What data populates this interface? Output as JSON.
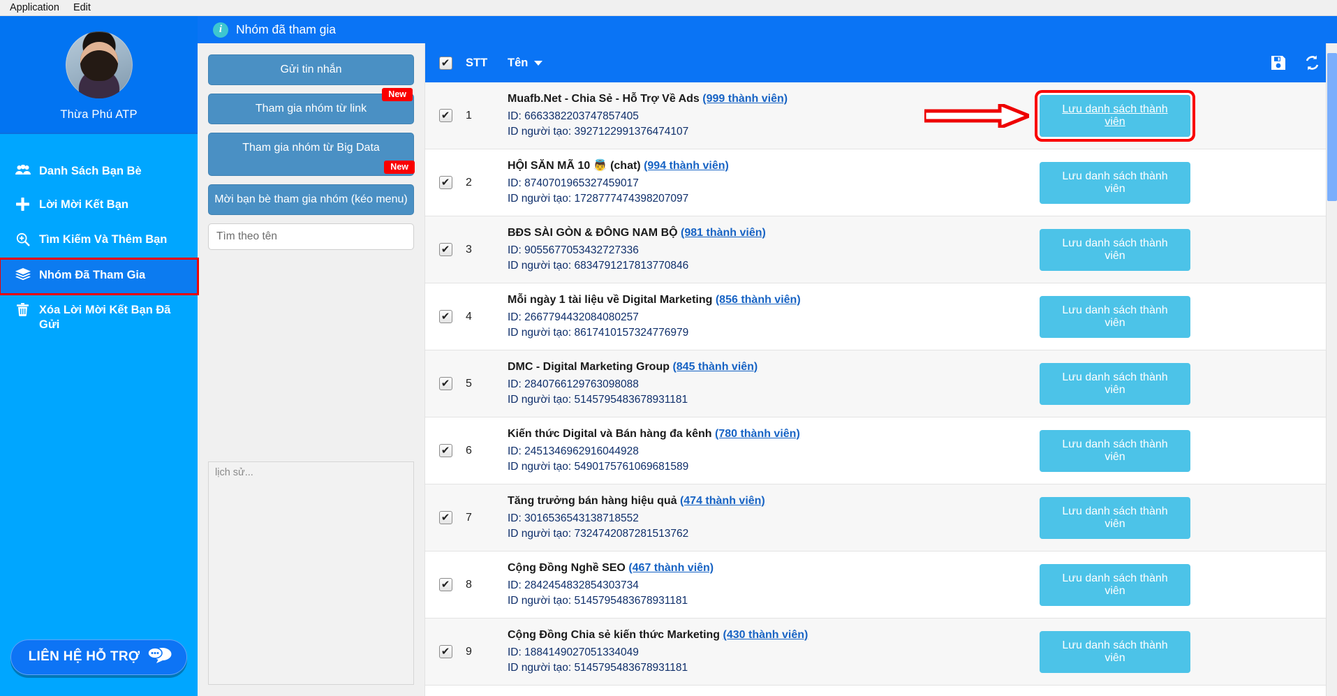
{
  "menubar": {
    "items": [
      "Application",
      "Edit"
    ]
  },
  "sidebar": {
    "profile": {
      "name": "Thừa Phú ATP",
      "avatar_alt": "avatar"
    },
    "items": [
      {
        "icon": "people-icon",
        "glyph": "👥",
        "label": "Danh Sách Bạn Bè"
      },
      {
        "icon": "plus-icon",
        "glyph": "➕",
        "label": "Lời Mời Kết Bạn"
      },
      {
        "icon": "search-plus-icon",
        "glyph": "⊕",
        "label": "Tìm Kiếm Và Thêm Bạn"
      },
      {
        "icon": "layers-icon",
        "glyph": "≣",
        "label": "Nhóm Đã Tham Gia"
      },
      {
        "icon": "trash-icon",
        "glyph": "🗑",
        "label": "Xóa Lời Mời Kết Bạn Đã Gửi"
      }
    ],
    "active_index": 3,
    "support_button": {
      "label": "LIÊN HỆ HỖ TRỢ",
      "icon": "chat-bubbles-icon"
    }
  },
  "titlebar": {
    "icon": "info-icon",
    "title": "Nhóm đã tham gia"
  },
  "tools": {
    "buttons": [
      {
        "label": "Gửi tin nhắn",
        "badge": ""
      },
      {
        "label": "Tham gia nhóm từ link",
        "badge": "New"
      },
      {
        "label": "Tham gia nhóm từ Big Data",
        "badge": "New"
      },
      {
        "label": "Mời bạn bè tham gia nhóm (kéo menu)",
        "badge": ""
      }
    ],
    "search": {
      "value": "",
      "placeholder": "Tìm theo tên"
    },
    "history": {
      "value": "",
      "placeholder": "lịch sử..."
    }
  },
  "table": {
    "header": {
      "select_all_checked": true,
      "stt": "STT",
      "name": "Tên",
      "sort_icon": "chevron-down-icon",
      "save_icon": "floppy-disk-icon",
      "refresh_icon": "refresh-icon"
    },
    "action_label": "Lưu danh sách thành viên",
    "id_prefix": "ID: ",
    "creator_prefix": "ID người tạo: ",
    "highlight_row_index": 0,
    "rows": [
      {
        "stt": "1",
        "checked": true,
        "name": "Muafb.Net - Chia Sẻ - Hỗ Trợ Về Ads",
        "emoji": "",
        "suffix": "",
        "members": "(999 thành viên)",
        "id": "6663382203747857405",
        "creator_id": "3927122991376474107"
      },
      {
        "stt": "2",
        "checked": true,
        "name": "HỘI SĂN MÃ 10",
        "emoji": "👼",
        "suffix": "(chat)",
        "members": "(994 thành viên)",
        "id": "8740701965327459017",
        "creator_id": "1728777474398207097"
      },
      {
        "stt": "3",
        "checked": true,
        "name": "BĐS SÀI GÒN & ĐÔNG NAM BỘ",
        "emoji": "",
        "suffix": "",
        "members": "(981 thành viên)",
        "id": "9055677053432727336",
        "creator_id": "6834791217813770846"
      },
      {
        "stt": "4",
        "checked": true,
        "name": "Mỗi ngày 1 tài liệu về Digital Marketing",
        "emoji": "",
        "suffix": "",
        "members": "(856 thành viên)",
        "id": "2667794432084080257",
        "creator_id": "8617410157324776979"
      },
      {
        "stt": "5",
        "checked": true,
        "name": "DMC - Digital Marketing Group",
        "emoji": "",
        "suffix": "",
        "members": "(845 thành viên)",
        "id": "2840766129763098088",
        "creator_id": "5145795483678931181"
      },
      {
        "stt": "6",
        "checked": true,
        "name": "Kiến thức Digital và Bán hàng đa kênh",
        "emoji": "",
        "suffix": "",
        "members": "(780 thành viên)",
        "id": "2451346962916044928",
        "creator_id": "5490175761069681589"
      },
      {
        "stt": "7",
        "checked": true,
        "name": "Tăng trưởng bán hàng hiệu quả",
        "emoji": "",
        "suffix": "",
        "members": "(474 thành viên)",
        "id": "3016536543138718552",
        "creator_id": "7324742087281513762"
      },
      {
        "stt": "8",
        "checked": true,
        "name": "Cộng Đồng Nghề SEO",
        "emoji": "",
        "suffix": "",
        "members": "(467 thành viên)",
        "id": "2842454832854303734",
        "creator_id": "5145795483678931181"
      },
      {
        "stt": "9",
        "checked": true,
        "name": "Cộng Đồng Chia sẻ kiến thức Marketing",
        "emoji": "",
        "suffix": "",
        "members": "(430 thành viên)",
        "id": "1884149027051334049",
        "creator_id": "5145795483678931181"
      }
    ]
  },
  "colors": {
    "brand_blue": "#0a74f5",
    "sidebar_blue": "#00a6ff",
    "tool_button": "#4a90c4",
    "action_button": "#4cc3e8",
    "badge_red": "#fa0000",
    "highlight_red": "#ee0000",
    "link_blue": "#1763c4"
  }
}
